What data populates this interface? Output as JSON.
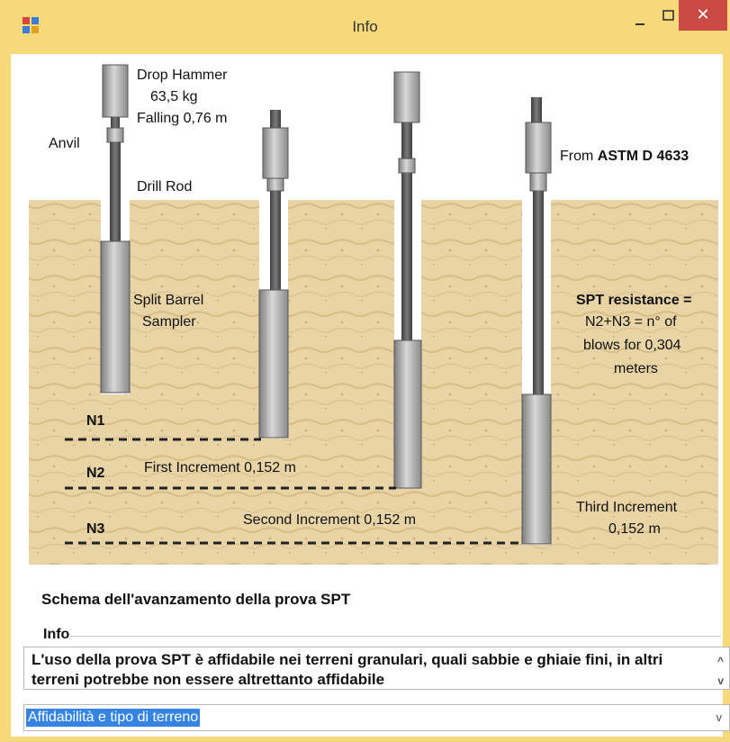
{
  "window": {
    "title": "Info",
    "controls": {
      "minimize": "–",
      "maximize": "□",
      "close": "✕"
    },
    "icons": {
      "app": "window-app-icon",
      "close": "close-icon"
    }
  },
  "diagram": {
    "labels": {
      "drop_hammer": "Drop Hammer",
      "mass": "63,5 kg",
      "falling": "Falling 0,76 m",
      "anvil": "Anvil",
      "drill_rod": "Drill Rod",
      "split_barrel_1": "Split Barrel",
      "split_barrel_2": "Sampler",
      "from_prefix": "From ",
      "from_standard": "ASTM D 4633",
      "spt_1": "SPT resistance =",
      "spt_2": "N2+N3 = n° of",
      "spt_3": "blows for 0,304",
      "spt_4": "meters",
      "n1": "N1",
      "n2": "N2",
      "n3": "N3",
      "first_increment": "First Increment 0,152 m",
      "second_increment": "Second Increment  0,152 m",
      "third_increment_1": "Third Increment",
      "third_increment_2": "0,152 m"
    },
    "colors": {
      "soil": "#e8d2a3",
      "soil_dark": "#d9bc84",
      "steel": "#9a9a9a",
      "rod": "#555555"
    }
  },
  "caption": "Schema dell'avanzamento della prova SPT",
  "info_group": {
    "label": "Info",
    "text": "L'uso della prova SPT è affidabile nei terreni granulari, quali sabbie e ghiaie fini, in altri terreni potrebbe non essere altrettanto affidabile",
    "scroll_up": "^",
    "scroll_down": "v"
  },
  "combo": {
    "value": "Affidabilità e tipo di terreno",
    "arrow": "v"
  }
}
